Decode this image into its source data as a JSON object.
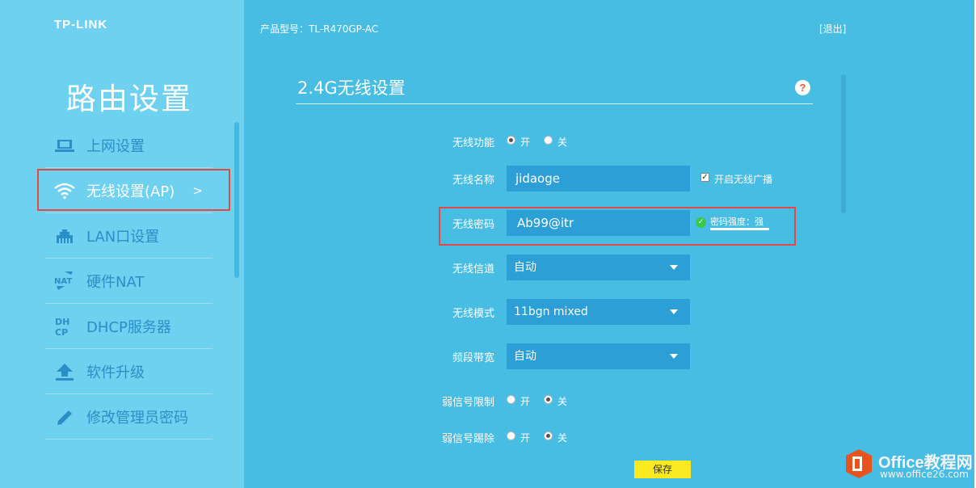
{
  "brand": {
    "logo": "TP-LINK",
    "logo_alt": "Office教程网",
    "domain": "www.office26.com"
  },
  "sidebar": {
    "title": "路由设置",
    "items": [
      {
        "label": "上网设置",
        "icon": "laptop-icon"
      },
      {
        "label": "无线设置(AP)",
        "icon": "wifi-icon",
        "active": true,
        "chevron": ">"
      },
      {
        "label": "LAN口设置",
        "icon": "lan-port-icon"
      },
      {
        "label": "硬件NAT",
        "icon": "nat-icon"
      },
      {
        "label": "DHCP服务器",
        "icon": "dhcp-icon"
      },
      {
        "label": "软件升级",
        "icon": "upgrade-icon"
      },
      {
        "label": "修改管理员密码",
        "icon": "pencil-icon"
      }
    ]
  },
  "header": {
    "model": "产品型号：TL-R470GP-AC",
    "logout": "[退出]"
  },
  "panel": {
    "title": "2.4G无线设置",
    "help": "?",
    "wireless_enable": {
      "label": "无线功能",
      "on": "开",
      "off": "关",
      "value": "on"
    },
    "ssid": {
      "label": "无线名称",
      "value": "jidaoge",
      "broadcast_label": "开启无线广播",
      "broadcast": true
    },
    "password": {
      "label": "无线密码",
      "value": "Ab99@itr",
      "strength": "密码强度：强"
    },
    "channel": {
      "label": "无线信道",
      "value": "自动"
    },
    "mode": {
      "label": "无线模式",
      "value": "11bgn mixed"
    },
    "bandwidth": {
      "label": "频段带宽",
      "value": "自动"
    },
    "weak_limit": {
      "label": "弱信号限制",
      "on": "开",
      "off": "关",
      "value": "off"
    },
    "weak_kick": {
      "label": "弱信号踢除",
      "on": "开",
      "off": "关",
      "value": "off"
    },
    "save": "保存"
  },
  "colors": {
    "sidebar": "#6ed1ef",
    "main": "#47bde4",
    "field": "#2c9fd6",
    "highlight": "#e34a45",
    "save": "#fbe920"
  }
}
